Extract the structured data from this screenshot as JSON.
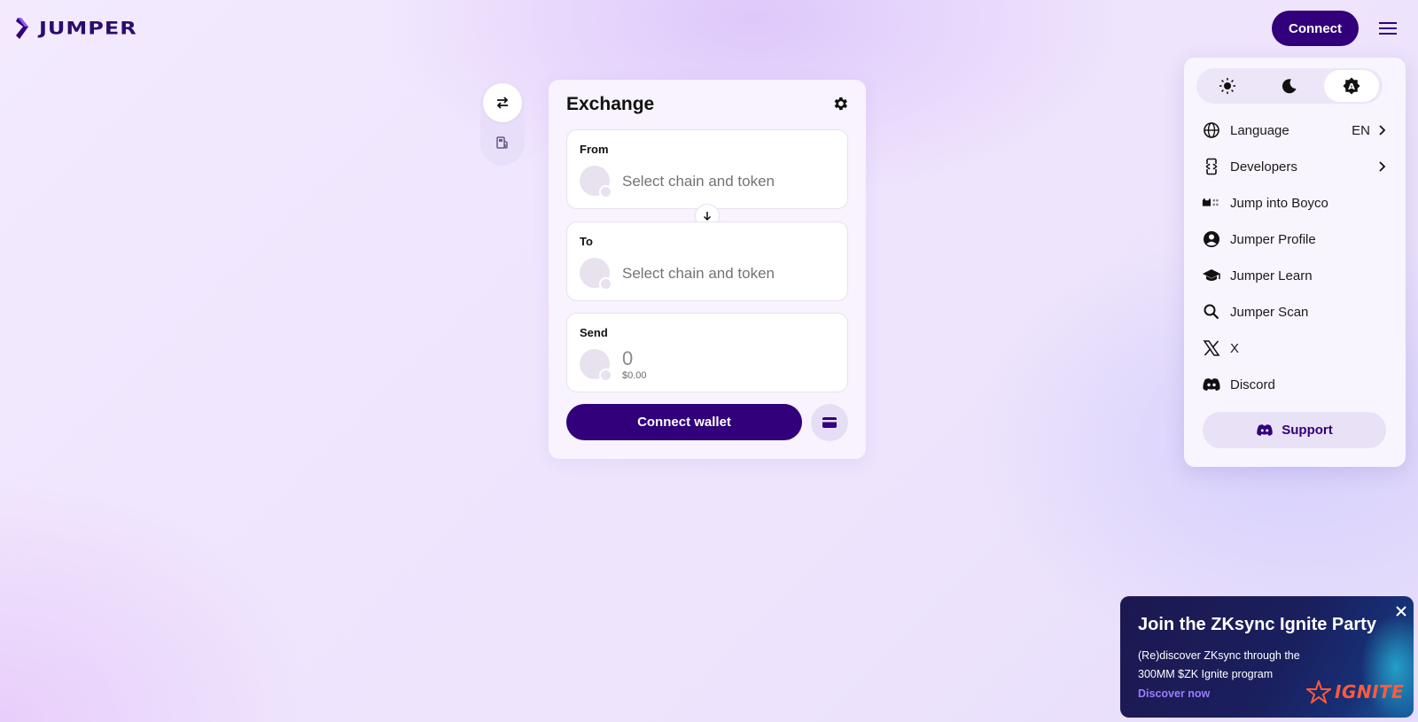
{
  "header": {
    "logo_text": "JUMPER",
    "connect_label": "Connect"
  },
  "side_tabs": [
    {
      "icon": "swap-arrows-icon",
      "active": true
    },
    {
      "icon": "gas-station-icon",
      "active": false
    }
  ],
  "exchange": {
    "title": "Exchange",
    "from": {
      "label": "From",
      "placeholder": "Select chain and token"
    },
    "to": {
      "label": "To",
      "placeholder": "Select chain and token"
    },
    "send": {
      "label": "Send",
      "amount": "0",
      "usd_value": "$0.00"
    },
    "connect_wallet_label": "Connect wallet"
  },
  "menu": {
    "theme_options": [
      {
        "icon": "sun-icon",
        "selected": false
      },
      {
        "icon": "moon-icon",
        "selected": false
      },
      {
        "icon": "auto-theme-icon",
        "selected": true
      }
    ],
    "items": [
      {
        "label": "Language",
        "value": "EN",
        "icon": "globe-icon",
        "has_chevron": true
      },
      {
        "label": "Developers",
        "icon": "code-icon",
        "has_chevron": true
      },
      {
        "label": "Jump into Boyco",
        "icon": "boyco-icon"
      },
      {
        "label": "Jumper Profile",
        "icon": "profile-icon"
      },
      {
        "label": "Jumper Learn",
        "icon": "graduation-cap-icon"
      },
      {
        "label": "Jumper Scan",
        "icon": "search-icon"
      },
      {
        "label": "X",
        "icon": "x-logo-icon"
      },
      {
        "label": "Discord",
        "icon": "discord-icon"
      }
    ],
    "support_label": "Support"
  },
  "promo": {
    "title": "Join the ZKsync Ignite Party",
    "subtitle": "(Re)discover ZKsync through the 300MM $ZK Ignite program",
    "link_label": "Discover now",
    "brand": "IGNITE"
  },
  "colors": {
    "primary": "#31007a",
    "card_bg": "#f8f3fe",
    "promo_link": "#9b7bff",
    "ignite_orange": "#ff5a3c"
  }
}
